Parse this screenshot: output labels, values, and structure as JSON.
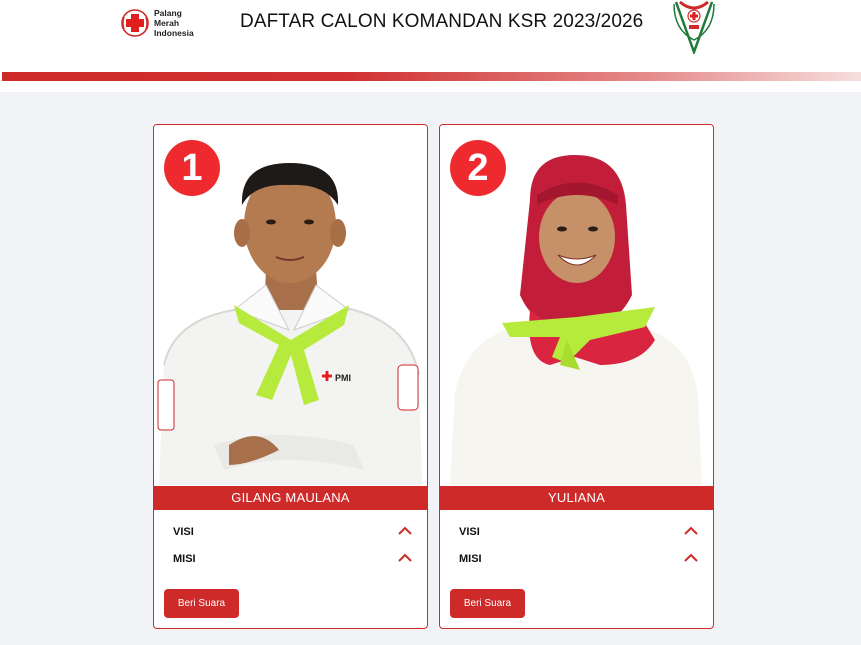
{
  "header": {
    "logo_text_lines": [
      "Palang",
      "Merah",
      "Indonesia"
    ],
    "title": "DAFTAR CALON KOMANDAN KSR 2023/2026",
    "ksr_logo_icon": "ksr-pmi-emblem"
  },
  "colors": {
    "brand_red": "#cf2a2a",
    "badge_red": "#ee2a2e",
    "page_bg": "#f1f3f6",
    "scarf_green": "#b6ea3c"
  },
  "candidates": [
    {
      "number": "1",
      "name": "GILANG MAULANA",
      "visi_label": "VISI",
      "misi_label": "MISI",
      "vote_label": "Beri Suara"
    },
    {
      "number": "2",
      "name": "YULIANA",
      "visi_label": "VISI",
      "misi_label": "MISI",
      "vote_label": "Beri Suara"
    }
  ]
}
